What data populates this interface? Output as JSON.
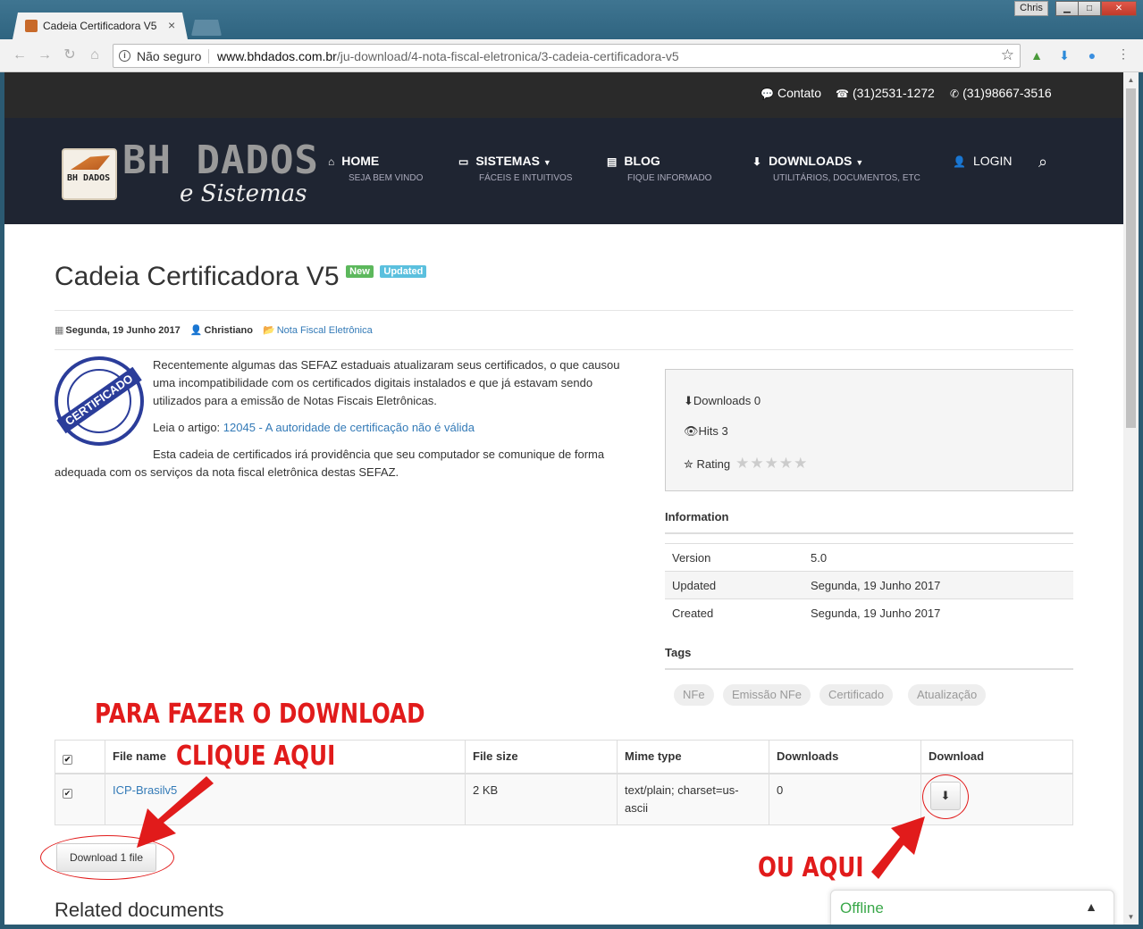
{
  "browser": {
    "tab_title": "Cadeia Certificadora V5",
    "tab_close": "×",
    "user": "Chris",
    "security_label": "Não seguro",
    "url_host": "www.bhdados.com.br",
    "url_path": "/ju-download/4-nota-fiscal-eletronica/3-cadeia-certificadora-v5"
  },
  "topbar": {
    "contact": "Contato",
    "phone1": "(31)2531-1272",
    "phone2": "(31)98667-3516"
  },
  "logo": {
    "text": "BH DADOS",
    "sub": "e Sistemas",
    "small": "BH DADOS"
  },
  "nav": [
    {
      "label": "HOME",
      "sub": "SEJA BEM VINDO"
    },
    {
      "label": "SISTEMAS",
      "sub": "FÁCEIS E INTUITIVOS"
    },
    {
      "label": "BLOG",
      "sub": "FIQUE INFORMADO"
    },
    {
      "label": "DOWNLOADS",
      "sub": "UTILITÁRIOS, DOCUMENTOS, ETC"
    },
    {
      "label": "LOGIN",
      "sub": ""
    }
  ],
  "page": {
    "title": "Cadeia Certificadora V5",
    "badge_new": "New",
    "badge_updated": "Updated",
    "date": "Segunda, 19 Junho 2017",
    "author": "Christiano",
    "category": "Nota Fiscal Eletrônica",
    "seal_text": "CERTIFICADO",
    "para1": "Recentemente algumas das SEFAZ estaduais atualizaram seus certificados, o que causou uma incompatibilidade com os certificados digitais instalados e que já estavam sendo utilizados para a emissão de Notas Fiscais Eletrônicas.",
    "read_prefix": "Leia o artigo:",
    "read_link": "12045 - A autoridade de certificação não é válida",
    "para2": "Esta cadeia de certificados irá providência que seu computador se comunique de forma adequada com os serviços da nota fiscal eletrônica destas SEFAZ."
  },
  "stats": {
    "downloads_label": "Downloads",
    "downloads": "0",
    "hits_label": "Hits",
    "hits": "3",
    "rating_label": "Rating",
    "rating_stars": "★★★★★"
  },
  "information": {
    "title": "Information",
    "rows": [
      {
        "k": "Version",
        "v": "5.0"
      },
      {
        "k": "Updated",
        "v": "Segunda, 19 Junho 2017"
      },
      {
        "k": "Created",
        "v": "Segunda, 19 Junho 2017"
      }
    ]
  },
  "tags": {
    "title": "Tags",
    "items": [
      "NFe",
      "Emissão NFe",
      "Certificado",
      "Atualização"
    ]
  },
  "files": {
    "headers": [
      "File name",
      "File size",
      "Mime type",
      "Downloads",
      "Download"
    ],
    "rows": [
      {
        "name": "ICP-Brasilv5",
        "size": "2 KB",
        "mime": "text/plain; charset=us-ascii",
        "downloads": "0"
      }
    ],
    "download_all": "Download 1 file"
  },
  "related_title": "Related documents",
  "annotations": {
    "line1": "PARA FAZER O DOWNLOAD",
    "line2": "CLIQUE AQUI",
    "line3": "OU AQUI"
  },
  "chat": {
    "status": "Offline"
  },
  "colors": {
    "annotation": "#e11b1b",
    "link": "#337ab7",
    "header_bg": "#1f2532"
  }
}
